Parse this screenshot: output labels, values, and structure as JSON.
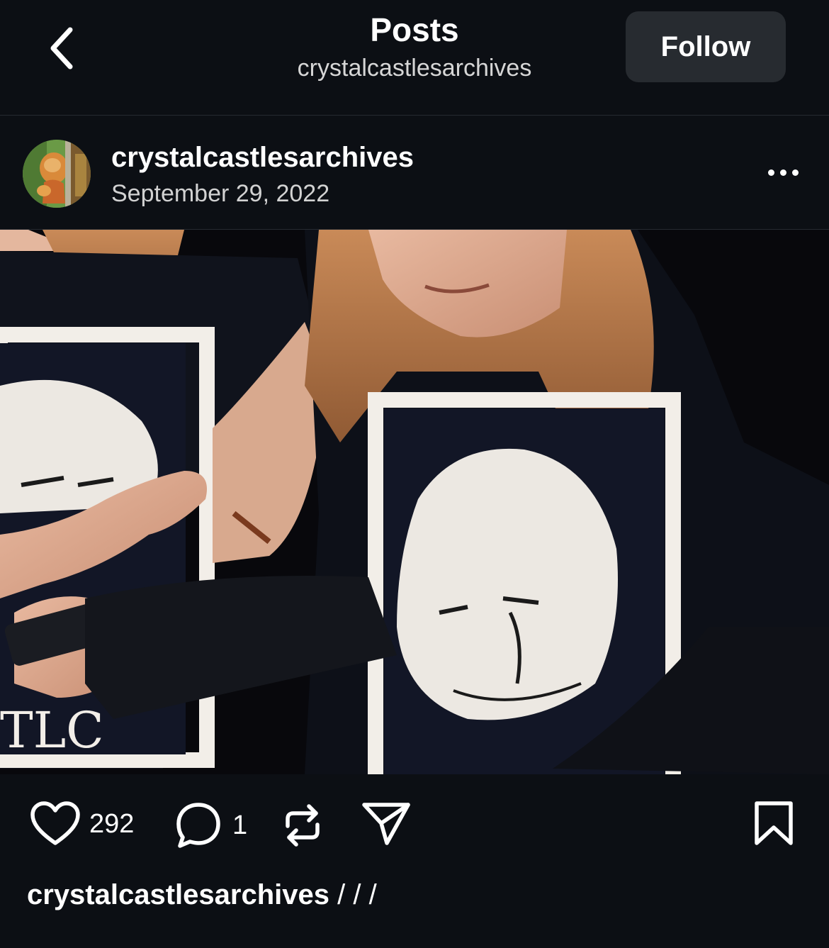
{
  "header": {
    "title": "Posts",
    "subtitle": "crystalcastlesarchives",
    "back_icon": "chevron-left-icon",
    "follow_label": "Follow"
  },
  "post": {
    "author": "crystalcastlesarchives",
    "date": "September 29, 2022",
    "more_icon": "ellipsis-icon",
    "image_alt": "Photo of two people wearing black t-shirts with a white printed face graphic"
  },
  "actions": {
    "like_count": "292",
    "comment_count": "1",
    "like_icon": "heart-icon",
    "comment_icon": "comment-bubble-icon",
    "repost_icon": "repost-icon",
    "share_icon": "send-icon",
    "bookmark_icon": "bookmark-icon"
  },
  "caption": {
    "username": "crystalcastlesarchives",
    "text": "/ / /"
  },
  "colors": {
    "background": "#0c0f14",
    "follow_bg": "#272b30",
    "text": "#ffffff"
  }
}
